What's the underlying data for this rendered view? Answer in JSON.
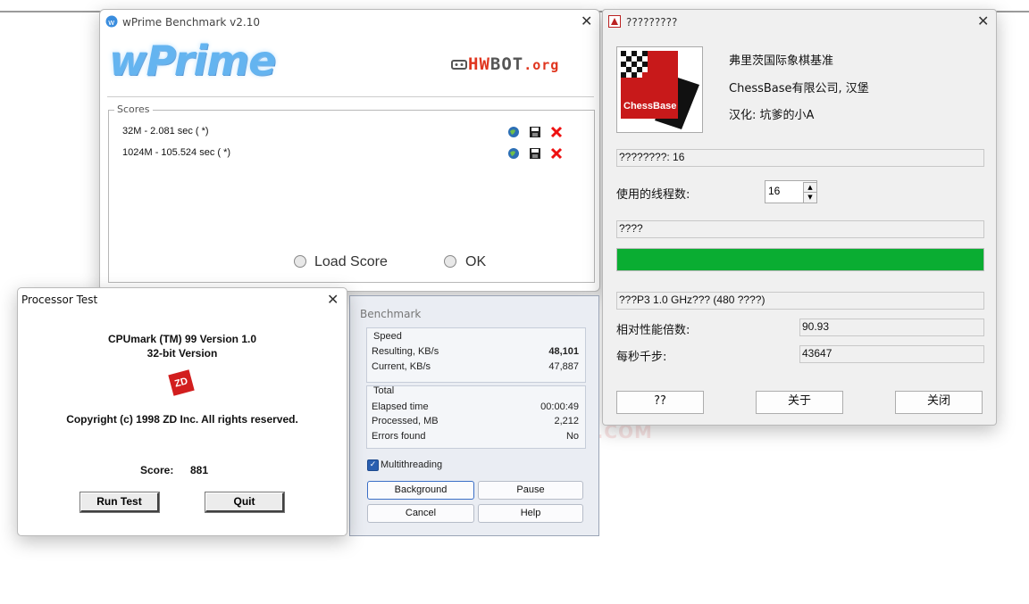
{
  "wprime": {
    "title": "wPrime Benchmark v2.10",
    "logo_text": "wPrime",
    "hwbot_a": "HW",
    "hwbot_b": "BOT",
    "hwbot_c": ".org",
    "scores_legend": "Scores",
    "scores": [
      {
        "text": "32M - 2.081 sec (  *)"
      },
      {
        "text": "1024M - 105.524 sec (  *)"
      }
    ],
    "load_score_label": "Load Score",
    "ok_label": "OK"
  },
  "chessbase": {
    "title": "?????????",
    "logo_text": "ChessBase",
    "line1": "弗里茨国际象棋基准",
    "line2": "ChessBase有限公司, 汉堡",
    "line3": "汉化: 坑爹的小A",
    "threads_field": "????????: 16",
    "threads_label": "使用的线程数:",
    "threads_value": "16",
    "status_field": "????",
    "progress_percent": 100,
    "progress_color": "#0aad32",
    "ref_field": "???P3 1.0 GHz??? (480 ????)",
    "ratio_label": "相对性能倍数:",
    "ratio_value": "90.93",
    "knps_label": "每秒千步:",
    "knps_value": "43647",
    "btn1": "??",
    "btn2": "关于",
    "btn3": "关闭"
  },
  "processor_test": {
    "title": "Processor Test",
    "line1": "CPUmark (TM) 99 Version 1.0",
    "line2": "32-bit Version",
    "zd_logo": "ZD",
    "copyright": "Copyright (c) 1998 ZD Inc. All rights reserved.",
    "score_label": "Score:",
    "score_value": "881",
    "run_test": "Run Test",
    "quit": "Quit"
  },
  "benchmark": {
    "title": "Benchmark",
    "speed_legend": "Speed",
    "resulting_label": "Resulting, KB/s",
    "resulting_value": "48,101",
    "current_label": "Current, KB/s",
    "current_value": "47,887",
    "total_legend": "Total",
    "elapsed_label": "Elapsed time",
    "elapsed_value": "00:00:49",
    "processed_label": "Processed, MB",
    "processed_value": "2,212",
    "errors_label": "Errors found",
    "errors_value": "No",
    "multithreading_label": "Multithreading",
    "multithreading_checked": true,
    "background": "Background",
    "pause": "Pause",
    "cancel": "Cancel",
    "help": "Help"
  },
  "watermark": "VMODTECH.COM",
  "colors": {
    "wprime_blue": "#64b4f0",
    "hwbot_red": "#e0361f",
    "chessbase_red": "#c8191a"
  }
}
